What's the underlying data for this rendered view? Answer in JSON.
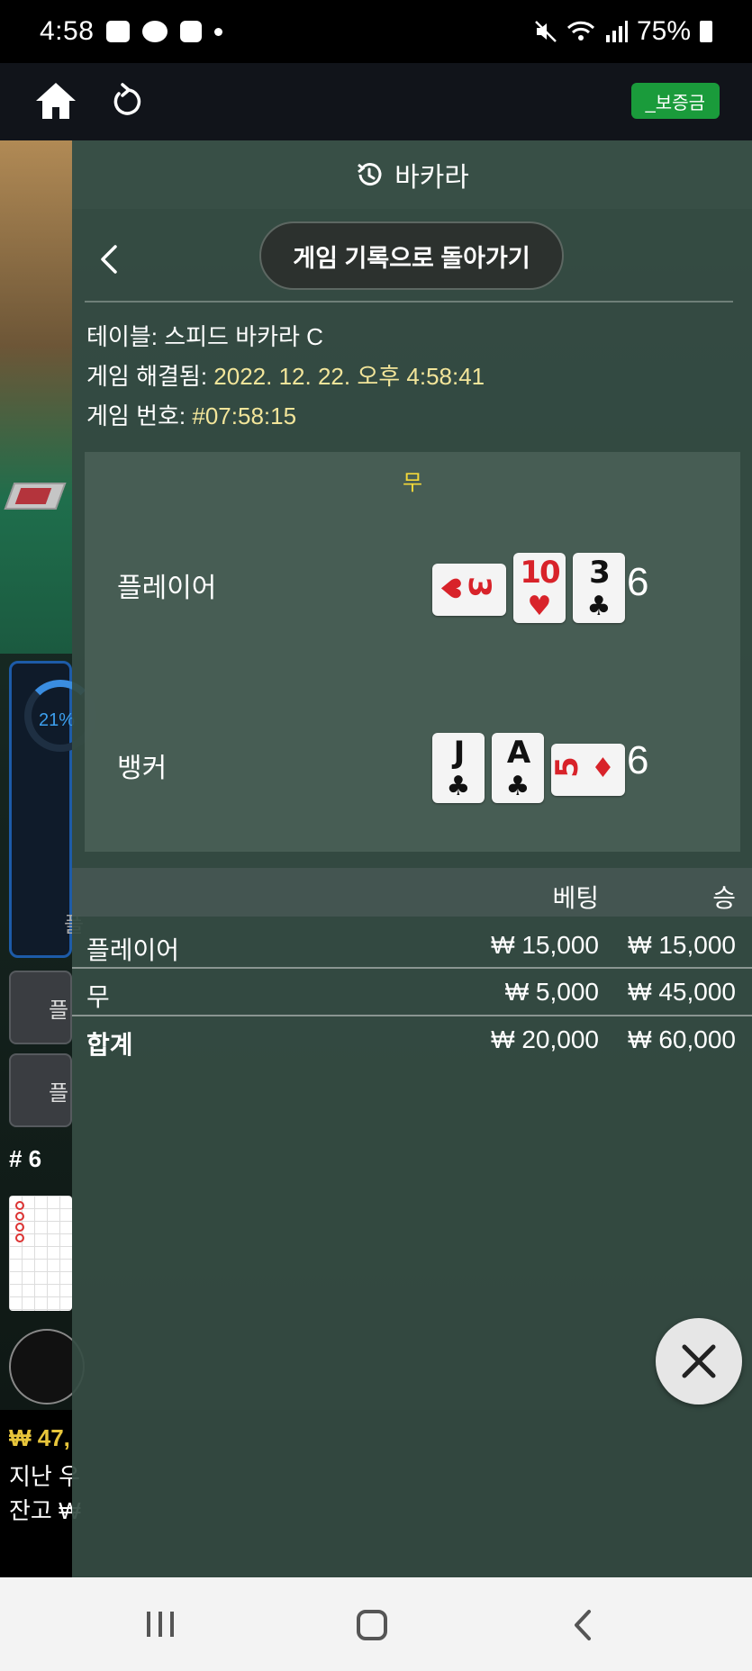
{
  "status_bar": {
    "time": "4:58",
    "battery": "75%"
  },
  "app_bar": {
    "deposit_label": "_보증금",
    "deposit_color": "#1a9b3b"
  },
  "background": {
    "progress_pct": "21%",
    "bottom_amount": "₩ 47,",
    "last_win_label": "지난 우",
    "balance_label": "잔고 ₩",
    "hash": "# 6"
  },
  "panel": {
    "title": "바카라",
    "back_button": "게임 기록으로 돌아가기",
    "table_label": "테이블:",
    "table_value": "스피드 바카라 C",
    "resolved_label": "게임 해결됨:",
    "resolved_value": "2022. 12. 22. 오후 4:58:41",
    "game_no_label": "게임 번호:",
    "game_no_value": "#07:58:15"
  },
  "result": {
    "outcome": "무",
    "player": {
      "label": "플레이어",
      "total": "6",
      "cards": [
        {
          "rank": "3",
          "suit": "♥",
          "color": "red",
          "orientation": "horizontal"
        },
        {
          "rank": "10",
          "suit": "♥",
          "color": "red",
          "orientation": "vertical"
        },
        {
          "rank": "3",
          "suit": "♣",
          "color": "black",
          "orientation": "vertical"
        }
      ]
    },
    "banker": {
      "label": "뱅커",
      "total": "6",
      "cards": [
        {
          "rank": "J",
          "suit": "♣",
          "color": "black",
          "orientation": "vertical"
        },
        {
          "rank": "A",
          "suit": "♣",
          "color": "black",
          "orientation": "vertical"
        },
        {
          "rank": "5",
          "suit": "♦",
          "color": "red",
          "orientation": "horizontal"
        }
      ]
    }
  },
  "bets": {
    "header_bet": "베팅",
    "header_win": "승",
    "rows": [
      {
        "name": "플레이어",
        "bet": "₩ 15,000",
        "win": "₩ 15,000"
      },
      {
        "name": "무",
        "bet": "₩ 5,000",
        "win": "₩ 45,000"
      }
    ],
    "total": {
      "name": "합계",
      "bet": "₩ 20,000",
      "win": "₩ 60,000"
    }
  }
}
